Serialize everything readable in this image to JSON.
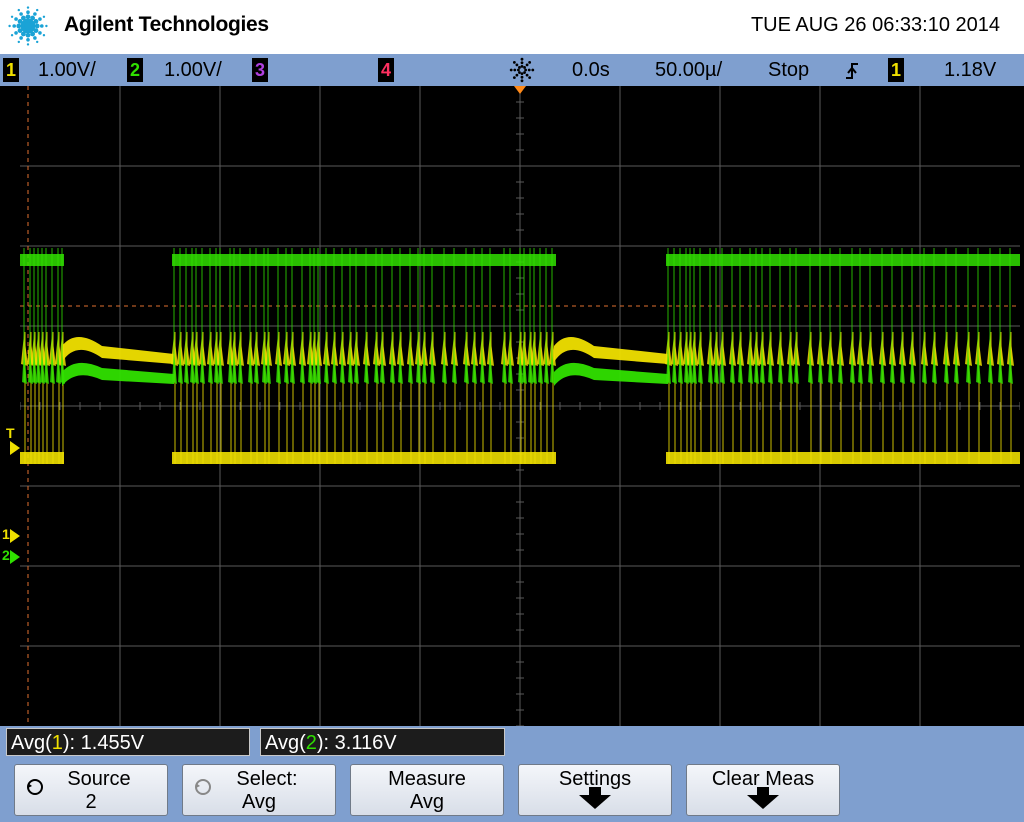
{
  "header": {
    "brand": "Agilent Technologies",
    "datetime": "TUE AUG 26 06:33:10 2014"
  },
  "status_bar": {
    "channels": [
      {
        "num": "1",
        "scale": "1.00V/",
        "color": "#f0e000"
      },
      {
        "num": "2",
        "scale": "1.00V/",
        "color": "#30e000"
      },
      {
        "num": "3",
        "scale": "",
        "color": "#b040e0"
      },
      {
        "num": "4",
        "scale": "",
        "color": "#ff3060"
      }
    ],
    "delay": "0.0s",
    "timebase": "50.00µ/",
    "run_state": "Stop",
    "trigger_source": "1",
    "trigger_level": "1.18V"
  },
  "screen": {
    "trigger_marker": "T",
    "ch1_marker": "1",
    "ch2_marker": "2"
  },
  "measurements": [
    {
      "label": "Avg(",
      "ch": "1",
      "rest": "): 1.455V",
      "color": "#f0e000"
    },
    {
      "label": "Avg(",
      "ch": "2",
      "rest": "): 3.116V",
      "color": "#30e000"
    }
  ],
  "softkeys": [
    {
      "line1": "Source",
      "line2": "2"
    },
    {
      "line1": "Select:",
      "line2": "Avg"
    },
    {
      "line1": "Measure",
      "line2": "Avg"
    },
    {
      "line1": "Settings",
      "line2": ""
    },
    {
      "line1": "Clear Meas",
      "line2": ""
    }
  ],
  "colors": {
    "ch1": "#f0e000",
    "ch2": "#30e000",
    "grid": "#5a5a5a",
    "trigger_level": "#e07030"
  }
}
